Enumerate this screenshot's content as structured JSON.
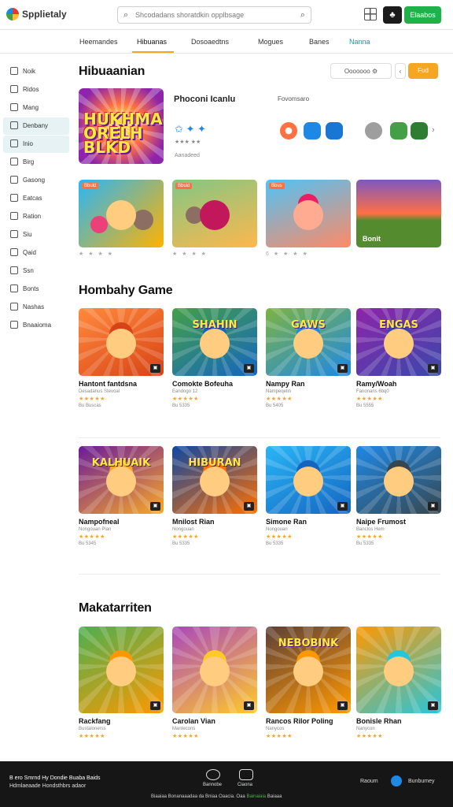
{
  "header": {
    "logo_text": "Spplietaly",
    "search_placeholder": "Shcodadans shoratdkin opplbsage",
    "dark_button_label": "♣",
    "green_button_label": "Elaabos"
  },
  "nav": [
    "Heemandes",
    "Hibuanas",
    "Dosoaedtns",
    "Mogues",
    "Banes",
    "Nanna"
  ],
  "sidebar": [
    "Noik",
    "Ridos",
    "Mang",
    "Denbany",
    "Inio",
    "Birg",
    "Gasong",
    "Eatcas",
    "Ration",
    "Siu",
    "Qaid",
    "Ssn",
    "Bonts",
    "Nashas",
    "Bnaaioma"
  ],
  "section1": {
    "title": "Hibuaanian",
    "filter_label": "Ooooooo",
    "orange_label": "Fud",
    "featured_title": "Phoconi Icanlu",
    "featured_meta": "Fovomsaro",
    "featured_badges": "✩ ✦ ✦",
    "featured_small": "Aanadeed",
    "featured_art_text": "HUKHMAK ORELH BLKD",
    "cards": [
      {
        "tag": "Bbuld",
        "rating": "★ ★ ★ ★"
      },
      {
        "tag": "Bbuld",
        "rating": "★ ★ ★ ★"
      },
      {
        "tag": "Bbus",
        "rating": "6 ★ ★ ★ ★"
      },
      {
        "tag": "Bonit",
        "rating": ""
      }
    ]
  },
  "section2": {
    "title": "Hombahy Game",
    "cards": [
      {
        "title": "Hantont fantdsna",
        "sub": "Desadanus Stevoal",
        "stars": "★★★★★",
        "meta": "Bu Buscas",
        "art": "",
        "colors": [
          "#ff8a3d",
          "#d84315"
        ]
      },
      {
        "title": "Comokte Bofeuha",
        "sub": "Eandogo 12",
        "stars": "★★★★★",
        "meta": "Bu 5335",
        "art": "SHAHIN",
        "colors": [
          "#43a047",
          "#1565c0"
        ]
      },
      {
        "title": "Nampy Ran",
        "sub": "Nampeqelin",
        "stars": "★★★★★",
        "meta": "Bu 5405",
        "art": "GAWS",
        "colors": [
          "#7cb342",
          "#1e88e5"
        ]
      },
      {
        "title": "Ramy/Woah",
        "sub": "Fanonans 6bq0",
        "stars": "★★★★★",
        "meta": "Bu 5555",
        "art": "ENGAS",
        "colors": [
          "#8e24aa",
          "#3949ab"
        ]
      },
      {
        "title": "Nampofneal",
        "sub": "Nongouan Plan",
        "stars": "★★★★★",
        "meta": "Bu 5345",
        "art": "KALHUAIK",
        "colors": [
          "#6a1b9a",
          "#f9a825"
        ]
      },
      {
        "title": "Mnilost Rian",
        "sub": "Nongouan",
        "stars": "★★★★★",
        "meta": "Bu 5335",
        "art": "HIBURAN",
        "colors": [
          "#0d47a1",
          "#ff6f00"
        ]
      },
      {
        "title": "Simone Ran",
        "sub": "Nongouan",
        "stars": "★★★★★",
        "meta": "Bu 5335",
        "art": "",
        "colors": [
          "#29b6f6",
          "#1565c0"
        ]
      },
      {
        "title": "Naipe Frumost",
        "sub": "Banclos Hem",
        "stars": "★★★★★",
        "meta": "Bu 5335",
        "art": "",
        "colors": [
          "#1e88e5",
          "#37474f"
        ]
      }
    ]
  },
  "section3": {
    "title": "Makatarriten",
    "cards": [
      {
        "title": "Rackfang",
        "sub": "Bustalonerss",
        "stars": "★★★★★",
        "meta": "",
        "art": "",
        "colors": [
          "#4caf50",
          "#ff9800"
        ]
      },
      {
        "title": "Carolan Vian",
        "sub": "Mantecons",
        "stars": "★★★★★",
        "meta": "",
        "art": "",
        "colors": [
          "#ab47bc",
          "#ffca28"
        ]
      },
      {
        "title": "Rancos Rilor Poling",
        "sub": "Nanycos",
        "stars": "★★★★★",
        "meta": "",
        "art": "NEBOBINK",
        "colors": [
          "#5d4037",
          "#ff9800"
        ]
      },
      {
        "title": "Bonisle Rhan",
        "sub": "Nanycon",
        "stars": "★★★★★",
        "meta": "",
        "art": "",
        "colors": [
          "#ff9800",
          "#26c6da"
        ]
      }
    ]
  },
  "footer": {
    "line1": "B ero Smrnd Hy Dondie Buaba Baids",
    "line2": "Hdmlaeaade Hondsthbrs adaor",
    "icon1_label": "Bannobe",
    "icon2_label": "Ciaona",
    "right_label": "Raoum",
    "right_label2": "Bunbumey",
    "bottom_text": "Biaaiaa Bonanaaadaa da Bniaa Oaacia. Oaa",
    "bottom_green": "Bainaiaia",
    "bottom_tail": "Baiaaa"
  }
}
